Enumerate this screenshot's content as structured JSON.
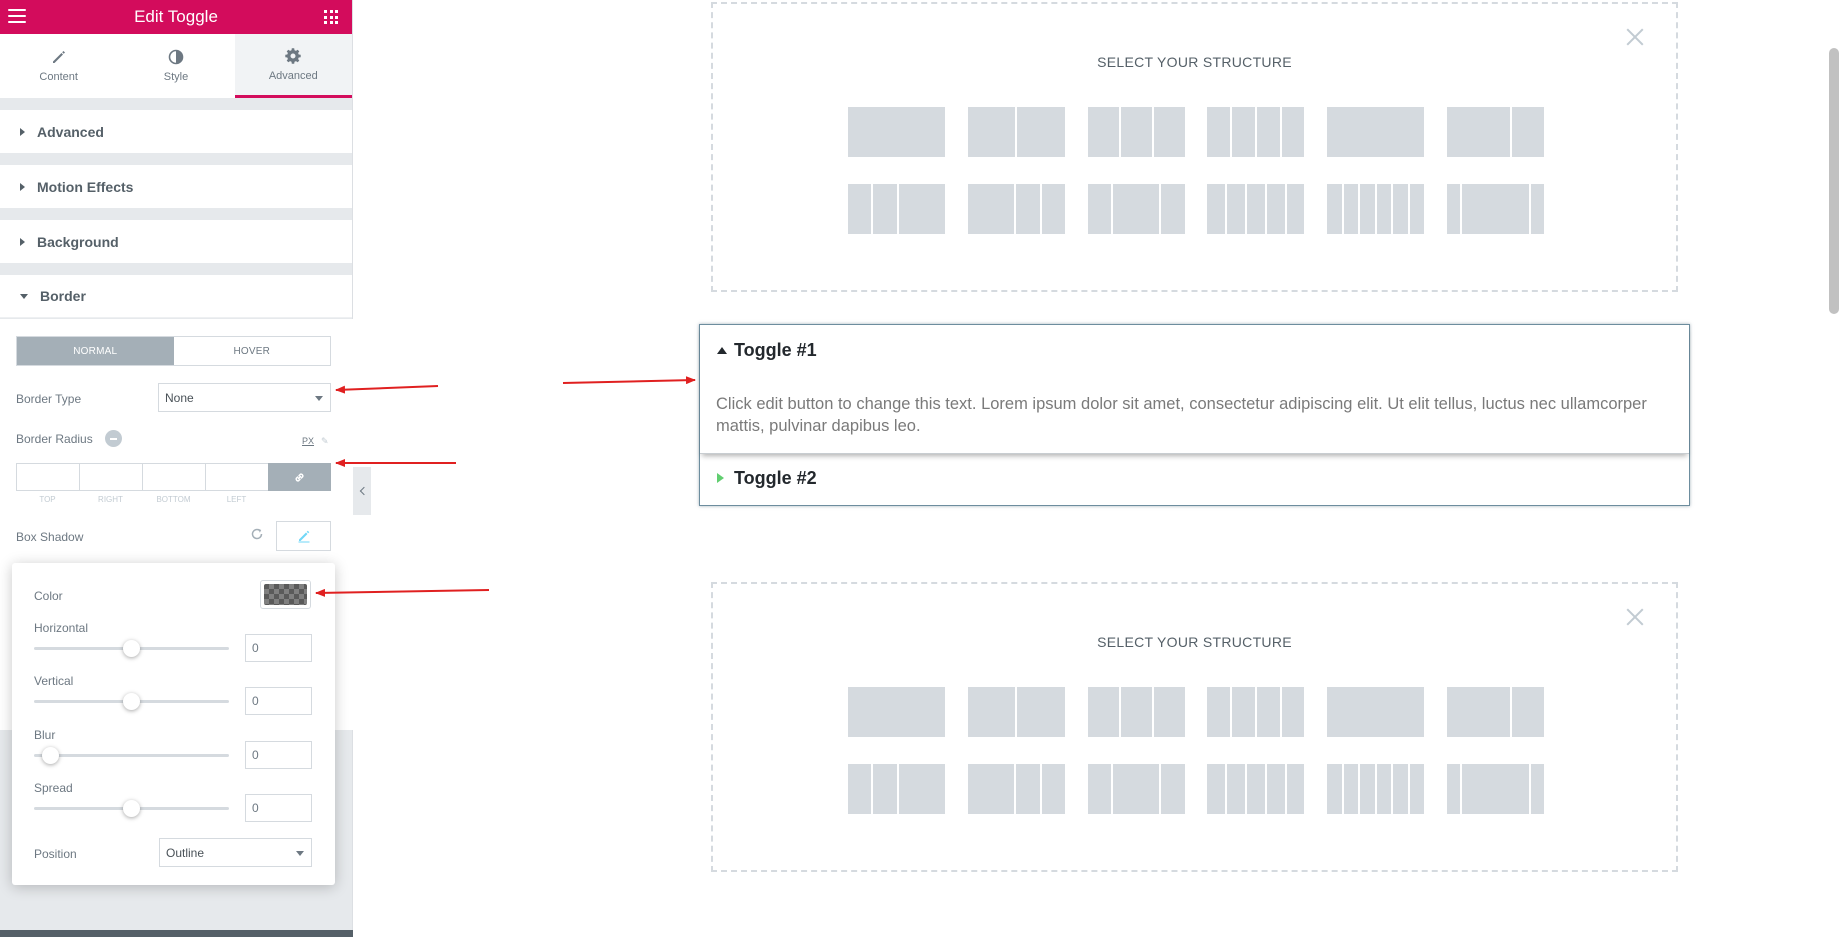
{
  "panel": {
    "title": "Edit Toggle",
    "tabs": [
      {
        "label": "Content",
        "icon": "pencil-icon"
      },
      {
        "label": "Style",
        "icon": "half-circle-icon"
      },
      {
        "label": "Advanced",
        "icon": "gear-icon",
        "active": true
      }
    ],
    "sections": [
      {
        "label": "Advanced"
      },
      {
        "label": "Motion Effects"
      },
      {
        "label": "Background"
      },
      {
        "label": "Border",
        "open": true
      }
    ],
    "border": {
      "state_tabs": [
        "NORMAL",
        "HOVER"
      ],
      "active_state": "NORMAL",
      "border_type_label": "Border Type",
      "border_type_value": "None",
      "border_radius_label": "Border Radius",
      "unit": "PX",
      "dimension_labels": [
        "TOP",
        "RIGHT",
        "BOTTOM",
        "LEFT"
      ],
      "box_shadow_label": "Box Shadow"
    }
  },
  "box_shadow": {
    "color_label": "Color",
    "horizontal_label": "Horizontal",
    "horizontal_value": "0",
    "vertical_label": "Vertical",
    "vertical_value": "0",
    "blur_label": "Blur",
    "blur_value": "0",
    "spread_label": "Spread",
    "spread_value": "0",
    "position_label": "Position",
    "position_value": "Outline",
    "slider_levels": {
      "horizontal": 0.5,
      "vertical": 0.5,
      "blur": 0.0,
      "spread": 0.5
    }
  },
  "canvas": {
    "structure_title": "SELECT YOUR STRUCTURE",
    "toggle_1_title": "Toggle #1",
    "toggle_1_content": "Click edit button to change this text. Lorem ipsum dolor sit amet, consectetur adipiscing elit. Ut elit tellus, luctus nec ullamcorper mattis, pulvinar dapibus leo.",
    "toggle_2_title": "Toggle #2"
  },
  "colors": {
    "brand": "#d30c5c",
    "annotation_arrow": "#e02020",
    "toggle_icon": "#61ce70"
  }
}
